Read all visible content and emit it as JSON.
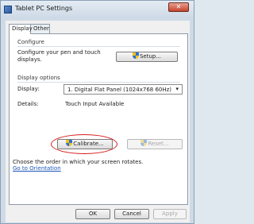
{
  "window": {
    "title": "Tablet PC Settings",
    "close_glyph": "✕"
  },
  "tabs": [
    {
      "label": "Display",
      "active": true
    },
    {
      "label": "Other",
      "active": false
    }
  ],
  "configure": {
    "group_label": "Configure",
    "description_line1": "Configure your pen and touch",
    "description_line2": "displays.",
    "setup_button": "Setup..."
  },
  "display_options": {
    "group_label": "Display options",
    "display_label": "Display:",
    "display_value": "1. Digital Flat Panel (1024x768 60Hz)",
    "details_label": "Details:",
    "details_value": "Touch Input Available",
    "calibrate_button": "Calibrate...",
    "reset_button": "Reset..."
  },
  "orientation": {
    "text": "Choose the order in which your screen rotates.",
    "link": "Go to Orientation"
  },
  "footer": {
    "ok": "OK",
    "cancel": "Cancel",
    "apply": "Apply"
  },
  "colors": {
    "highlight": "#d71e1e",
    "link": "#1a55b8"
  },
  "icons": {
    "title": "tablet-pc-icon",
    "uac": "uac-shield-icon",
    "dropdown": "chevron-down-icon"
  }
}
